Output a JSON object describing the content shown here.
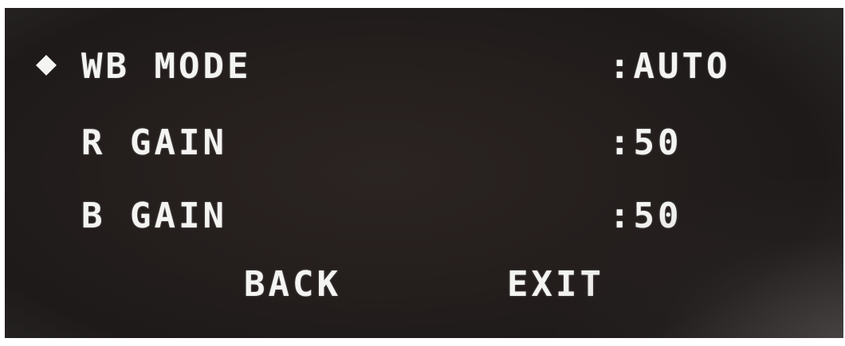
{
  "menu": {
    "cursor_icon": "diamond-icon",
    "items": [
      {
        "label": "WB MODE",
        "value": ":AUTO"
      },
      {
        "label": "R GAIN",
        "value": ":50"
      },
      {
        "label": "B GAIN",
        "value": ":50"
      }
    ],
    "actions": {
      "back_label": "BACK",
      "exit_label": "EXIT"
    }
  },
  "colors": {
    "text": "#f4f4f2",
    "background": "#241e1d"
  }
}
